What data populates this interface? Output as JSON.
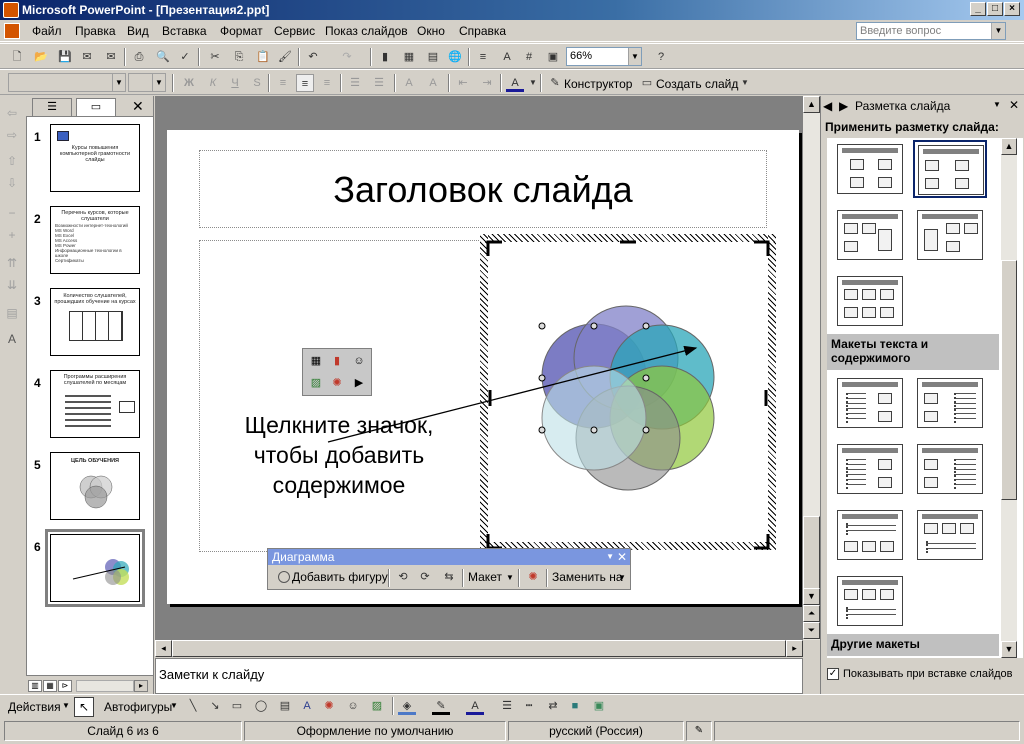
{
  "window": {
    "title": "Microsoft PowerPoint - [Презентация2.ppt]"
  },
  "menu": [
    "Файл",
    "Правка",
    "Вид",
    "Вставка",
    "Формат",
    "Сервис",
    "Показ слайдов",
    "Окно",
    "Справка"
  ],
  "help": {
    "placeholder": "Введите вопрос"
  },
  "toolbar": {
    "zoom": "66%",
    "design_label": "Конструктор",
    "new_slide_label": "Создать слайд"
  },
  "thumbnails": [
    {
      "num": "1",
      "title": "Курсы повышения компьютерной грамотности слайды"
    },
    {
      "num": "2",
      "title": "Перечень курсов, которые слушатели",
      "lines": [
        "Возможности интернет-технологий",
        "MS Word",
        "MS Excel",
        "MS Access",
        "MS Power",
        "Информационные технологии в школе",
        "Сертификаты"
      ]
    },
    {
      "num": "3",
      "title": "Количество слушателей, прошедших обучение на курсах"
    },
    {
      "num": "4",
      "title": "Программы расширения слушателей по месяцам"
    },
    {
      "num": "5",
      "title": "ЦЕЛЬ ОБУЧЕНИЯ"
    },
    {
      "num": "6",
      "title": ""
    }
  ],
  "slide": {
    "title": "Заголовок слайда",
    "content_hint": "Щелкните значок, чтобы добавить содержимое"
  },
  "diagram_toolbar": {
    "caption": "Диаграмма",
    "add_shape": "Добавить фигуру",
    "layout": "Макет",
    "change_to": "Заменить на"
  },
  "notes": {
    "placeholder": "Заметки к слайду"
  },
  "task_pane": {
    "title": "Разметка слайда",
    "apply_label": "Применить разметку слайда:",
    "section_text_content": "Макеты текста и содержимого",
    "section_other": "Другие макеты",
    "show_on_insert": "Показывать при вставке слайдов"
  },
  "drawing": {
    "actions": "Действия",
    "autoshapes": "Автофигуры"
  },
  "status": {
    "slide": "Слайд 6 из 6",
    "design": "Оформление по умолчанию",
    "language": "русский (Россия)"
  },
  "colors": {
    "venn": [
      "#5b5bb5",
      "#2aa6b8",
      "#90c83a",
      "#c4df5a",
      "#8c8c8c",
      "#bcdfe6"
    ]
  }
}
